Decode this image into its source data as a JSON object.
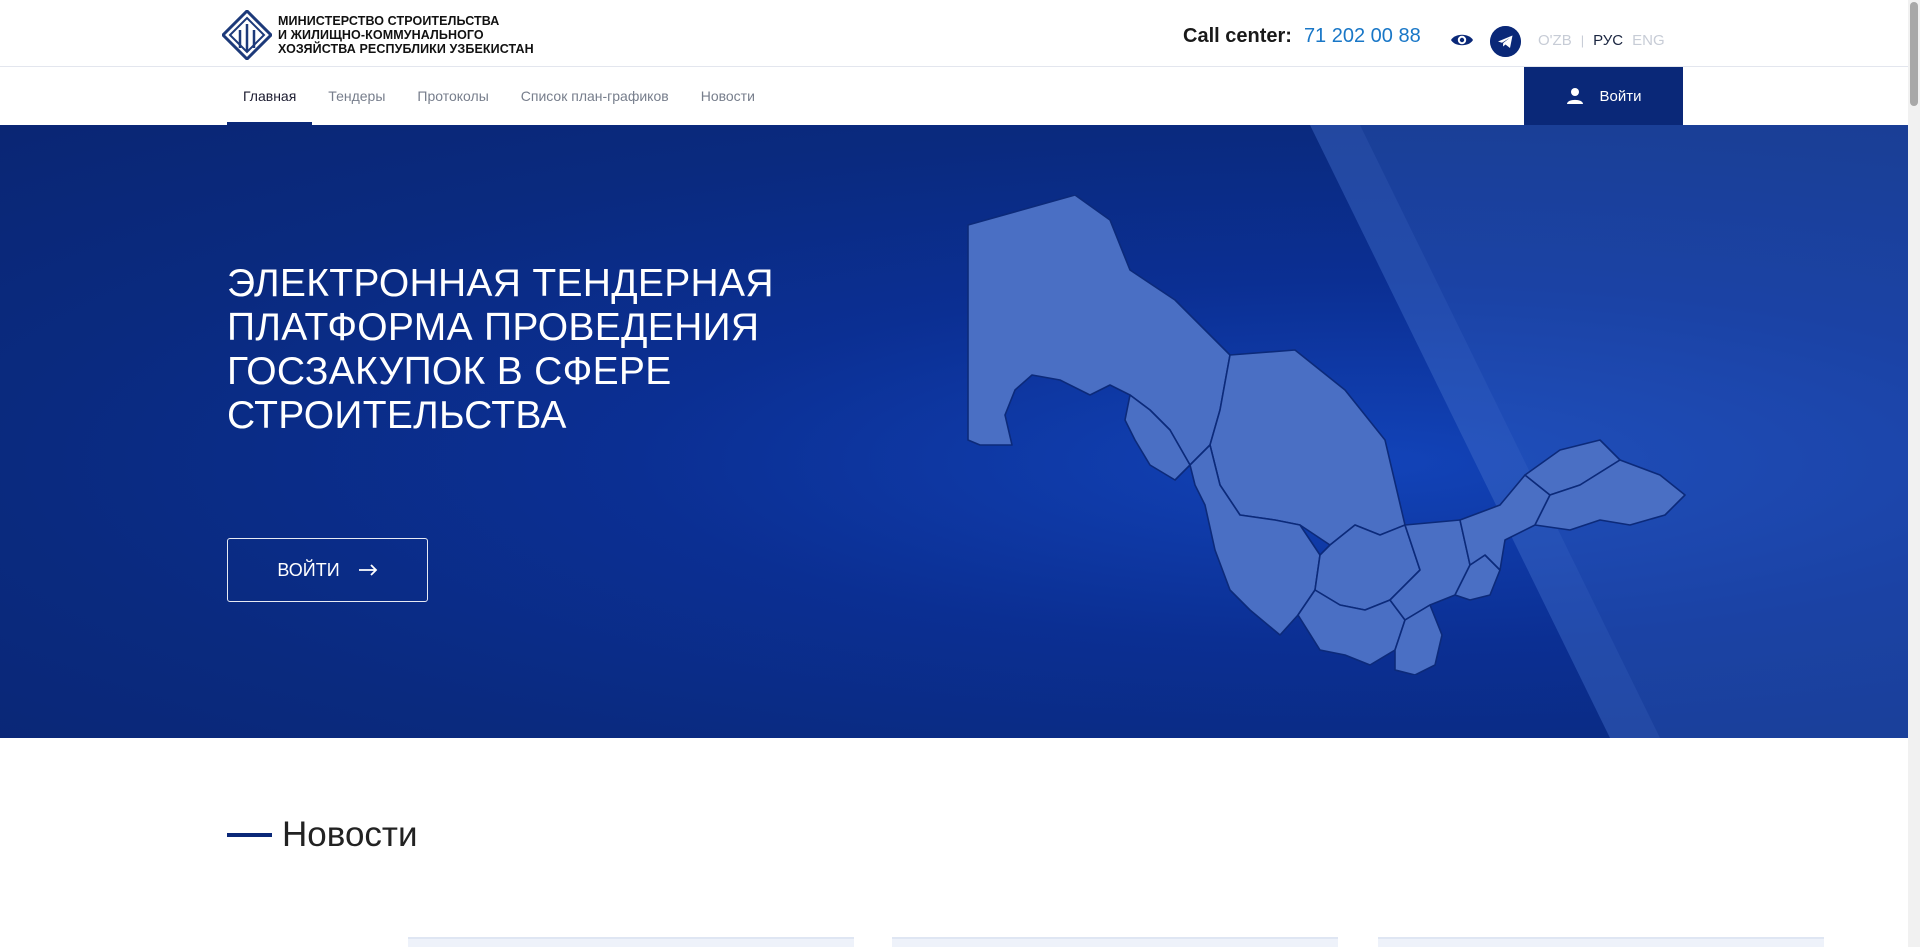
{
  "header": {
    "logo_lines": [
      "МИНИСТЕРСТВО СТРОИТЕЛЬСТВА",
      "И ЖИЛИЩНО-КОММУНАЛЬНОГО",
      "ХОЗЯЙСТВА РЕСПУБЛИКИ УЗБЕКИСТАН"
    ],
    "call_center_label": "Call center:",
    "call_center_phone": "71 202 00 88",
    "languages": [
      {
        "label": "O'ZB",
        "active": false
      },
      {
        "label": "РУС",
        "active": true
      },
      {
        "label": "ENG",
        "active": false
      }
    ],
    "icons": [
      "eye-icon",
      "telegram-icon"
    ]
  },
  "nav": {
    "items": [
      {
        "label": "Главная",
        "active": true
      },
      {
        "label": "Тендеры",
        "active": false
      },
      {
        "label": "Протоколы",
        "active": false
      },
      {
        "label": "Список план-графиков",
        "active": false
      },
      {
        "label": "Новости",
        "active": false
      }
    ],
    "login_label": "Войти"
  },
  "hero": {
    "title": "ЭЛЕКТРОННАЯ ТЕНДЕРНАЯ ПЛАТФОРМА ПРОВЕДЕНИЯ ГОСЗАКУПОК В СФЕРЕ СТРОИТЕЛЬСТВА",
    "button_label": "ВОЙТИ",
    "icon": "uzbekistan-map"
  },
  "news": {
    "heading": "Новости"
  },
  "colors": {
    "brand": "#0a2878",
    "hero_bg": "#0b2f93",
    "phone": "#1977c7",
    "map_fill": "#4a6fc4"
  }
}
